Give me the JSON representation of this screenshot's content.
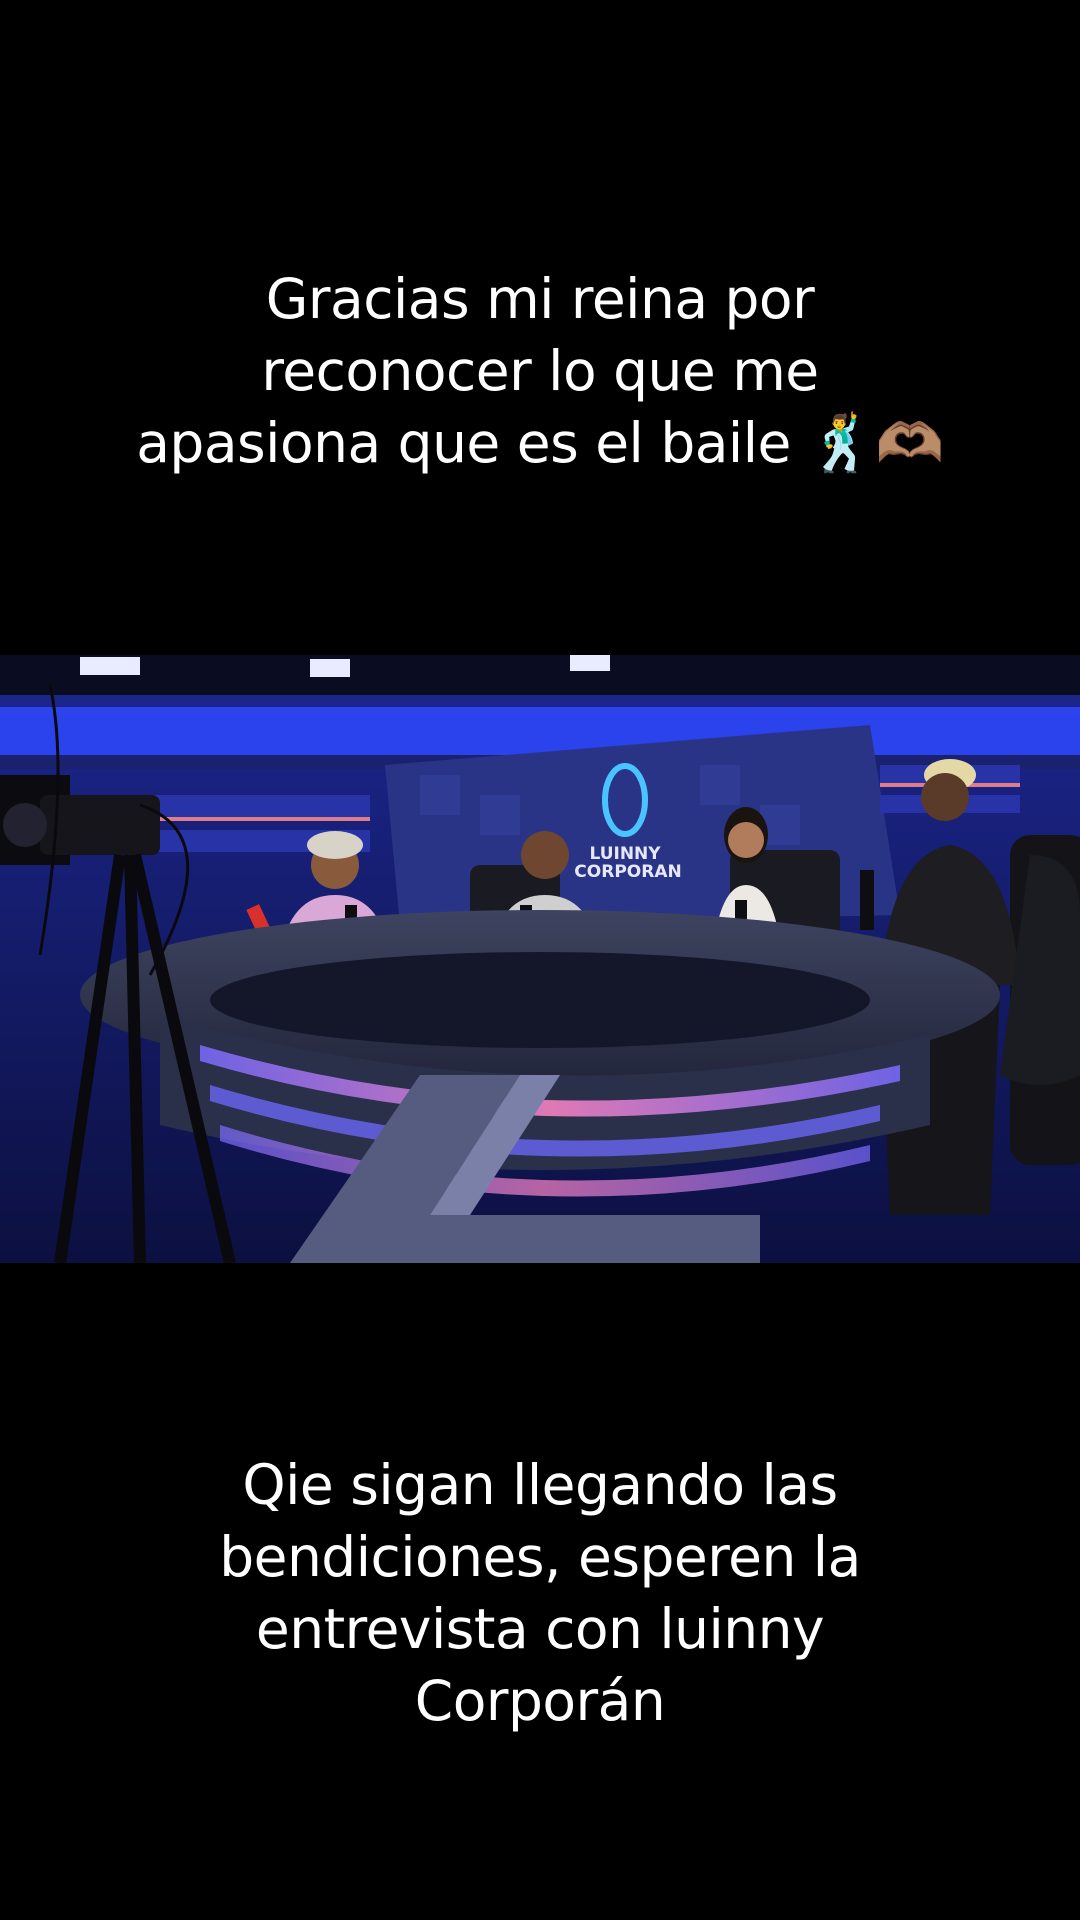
{
  "captions": {
    "top": "Gracias mi reina por\nreconocer lo que me\napasiona que es el baile 🕺🫶🏽",
    "bottom": "Qie sigan llegando las\nbendiciones, esperen la\nentrevista con luinny\nCorporán"
  },
  "video": {
    "studio_logo": "LUINNY\nCORPORAN",
    "colors": {
      "studio_blue": "#2a3fd8",
      "studio_dark": "#121634",
      "desk_gray": "#3a3f5a",
      "accent_pink": "#e05aa8"
    }
  }
}
